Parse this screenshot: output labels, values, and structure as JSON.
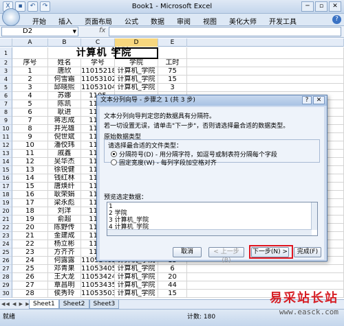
{
  "window": {
    "title": "Book1 - Microsoft Excel",
    "min": "─",
    "max": "▫",
    "close": "✕"
  },
  "ribbon": {
    "tabs": [
      "开始",
      "插入",
      "页面布局",
      "公式",
      "数据",
      "审阅",
      "视图",
      "美化大师",
      "开发工具"
    ],
    "help": "?"
  },
  "formula_bar": {
    "name_box": "D2",
    "fx": "fx",
    "value": ""
  },
  "grid": {
    "columns": [
      "A",
      "B",
      "C",
      "D",
      "E"
    ],
    "title": "计算机  学院",
    "headers": [
      "序号",
      "姓名",
      "学号",
      "学院",
      "工时"
    ],
    "rows": [
      {
        "n": "2",
        "a": "1",
        "b": "唐欣",
        "c": "11015218",
        "d": "计算机_学院",
        "e": "75"
      },
      {
        "n": "3",
        "a": "2",
        "b": "何雪霜",
        "c": "11053102",
        "d": "计算机_学院",
        "e": "15"
      },
      {
        "n": "4",
        "a": "3",
        "b": "邱晓熙",
        "c": "11053104",
        "d": "计算机_学院",
        "e": "3"
      },
      {
        "n": "5",
        "a": "4",
        "b": "苏娜",
        "c": "1105",
        "d": "",
        "e": ""
      },
      {
        "n": "6",
        "a": "5",
        "b": "陈凯",
        "c": "1105",
        "d": "",
        "e": ""
      },
      {
        "n": "7",
        "a": "6",
        "b": "耿进",
        "c": "1105",
        "d": "",
        "e": ""
      },
      {
        "n": "8",
        "a": "7",
        "b": "蒋志成",
        "c": "1105",
        "d": "",
        "e": ""
      },
      {
        "n": "9",
        "a": "8",
        "b": "井光雄",
        "c": "1105",
        "d": "",
        "e": ""
      },
      {
        "n": "10",
        "a": "9",
        "b": "倪世斌",
        "c": "1105",
        "d": "",
        "e": ""
      },
      {
        "n": "11",
        "a": "10",
        "b": "潘佼玮",
        "c": "1105",
        "d": "",
        "e": ""
      },
      {
        "n": "12",
        "a": "11",
        "b": "戚鑫",
        "c": "1105",
        "d": "",
        "e": ""
      },
      {
        "n": "13",
        "a": "12",
        "b": "吴华杰",
        "c": "1105",
        "d": "",
        "e": ""
      },
      {
        "n": "14",
        "a": "13",
        "b": "徐锐健",
        "c": "1105",
        "d": "",
        "e": ""
      },
      {
        "n": "15",
        "a": "14",
        "b": "钱红林",
        "c": "1105",
        "d": "",
        "e": ""
      },
      {
        "n": "16",
        "a": "15",
        "b": "唐焕纤",
        "c": "1105",
        "d": "",
        "e": ""
      },
      {
        "n": "17",
        "a": "16",
        "b": "耿荣娟",
        "c": "1105",
        "d": "",
        "e": ""
      },
      {
        "n": "18",
        "a": "17",
        "b": "梁永彪",
        "c": "1105",
        "d": "",
        "e": ""
      },
      {
        "n": "19",
        "a": "18",
        "b": "刘洋",
        "c": "1105",
        "d": "",
        "e": ""
      },
      {
        "n": "20",
        "a": "19",
        "b": "俞超",
        "c": "1105",
        "d": "",
        "e": ""
      },
      {
        "n": "21",
        "a": "20",
        "b": "陈野传",
        "c": "1105",
        "d": "",
        "e": ""
      },
      {
        "n": "22",
        "a": "21",
        "b": "金建成",
        "c": "1105",
        "d": "",
        "e": ""
      },
      {
        "n": "23",
        "a": "22",
        "b": "杨立彬",
        "c": "1105",
        "d": "",
        "e": ""
      },
      {
        "n": "24",
        "a": "23",
        "b": "方齐齐",
        "c": "1105",
        "d": "",
        "e": ""
      },
      {
        "n": "25",
        "a": "24",
        "b": "何露露",
        "c": "11053403",
        "d": "计算机_学院",
        "e": "15"
      },
      {
        "n": "26",
        "a": "25",
        "b": "邓青果",
        "c": "11053405",
        "d": "计算机_学院",
        "e": "6"
      },
      {
        "n": "27",
        "a": "26",
        "b": "王大龙",
        "c": "11053424",
        "d": "计算机_学院",
        "e": "20"
      },
      {
        "n": "28",
        "a": "27",
        "b": "覃昌明",
        "c": "11053435",
        "d": "计算机_学院",
        "e": "44"
      },
      {
        "n": "29",
        "a": "28",
        "b": "侯秀玲",
        "c": "11053503",
        "d": "计算机_学院",
        "e": "15"
      }
    ]
  },
  "sheets": [
    "Sheet1",
    "Sheet2",
    "Sheet3"
  ],
  "status": {
    "mode": "就绪",
    "count": "计数: 180"
  },
  "dialog": {
    "title": "文本分列向导 - 步骤之 1 (共 3 步)",
    "help": "?",
    "close": "✕",
    "line1": "文本分列向导判定您的数据具有分隔符。",
    "line2": "若一切设置无误，请单击\"下一步\"，否则请选择最合适的数据类型。",
    "group_label": "原始数据类型",
    "prompt": "请选择最合适的文件类型：",
    "opt1": "分隔符号(D)  - 用分隔字符，如逗号或制表符分隔每个字段",
    "opt2": "固定宽度(W)  - 每列字段加空格对齐",
    "preview_label": "预览选定数据：",
    "preview_lines": [
      "1",
      "2 学院",
      "3 计算机_学院",
      "4 计算机_学院"
    ],
    "btn_cancel": "取消",
    "btn_back": "< 上一步(B)",
    "btn_next": "下一步(N) >",
    "btn_finish": "完成(F)"
  },
  "watermark": {
    "line1": "易采站长站",
    "line2": "www.easck.com"
  }
}
